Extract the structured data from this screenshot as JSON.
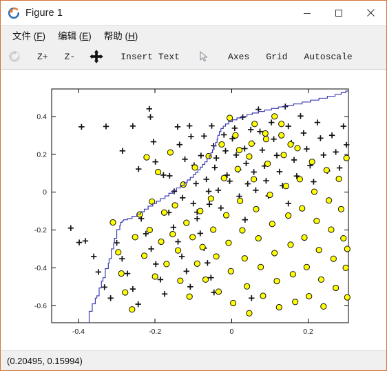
{
  "window": {
    "title": "Figure 1",
    "icon": "octave-logo-icon",
    "border_color": "#d4713a",
    "controls": [
      {
        "name": "minimize-button",
        "glyph": "minimize-icon"
      },
      {
        "name": "maximize-button",
        "glyph": "maximize-icon"
      },
      {
        "name": "close-button",
        "glyph": "close-icon"
      }
    ]
  },
  "menubar": {
    "items": [
      {
        "label": "文件 (F)",
        "text": "文件 (",
        "accel": "F",
        "tail": ")",
        "name": "menu-file"
      },
      {
        "label": "编辑 (E)",
        "text": "编辑 (",
        "accel": "E",
        "tail": ")",
        "name": "menu-edit"
      },
      {
        "label": "帮助 (H)",
        "text": "帮助 (",
        "accel": "H",
        "tail": ")",
        "name": "menu-help"
      }
    ]
  },
  "toolbar": {
    "reset_icon": "reset-rotate-icon",
    "zoom_in": "Z+",
    "zoom_out": "Z-",
    "pan_icon": "pan-move-icon",
    "insert_text": "Insert Text",
    "pointer_icon": "cursor-arrow-icon",
    "axes": "Axes",
    "grid": "Grid",
    "autoscale": "Autoscale"
  },
  "statusbar": {
    "coordinates": "(0.20495, 0.15994)"
  },
  "chart_data": {
    "type": "scatter",
    "title": "",
    "xlabel": "",
    "ylabel": "",
    "xlim": [
      -0.47,
      0.305
    ],
    "ylim": [
      -0.69,
      0.545
    ],
    "xticks": [
      -0.4,
      -0.2,
      0,
      0.2
    ],
    "xticklabels": [
      "-0.4",
      "-0.2",
      "0",
      "0.2"
    ],
    "yticks": [
      0.4,
      0.2,
      0,
      -0.2,
      -0.4,
      -0.6
    ],
    "yticklabels": [
      "0.4",
      "0.2",
      "0",
      "-0.2",
      "-0.4",
      "-0.6"
    ],
    "grid": false,
    "legend": null,
    "series": [
      {
        "name": "class-plus",
        "marker": "plus",
        "color": "#111111",
        "points": [
          [
            -0.392,
            0.345
          ],
          [
            -0.328,
            0.347
          ],
          [
            -0.285,
            0.218
          ],
          [
            -0.258,
            0.349
          ],
          [
            -0.243,
            0.122
          ],
          [
            -0.215,
            0.44
          ],
          [
            -0.212,
            0.397
          ],
          [
            -0.204,
            0.266
          ],
          [
            -0.199,
            0.16
          ],
          [
            -0.178,
            0.09
          ],
          [
            -0.162,
            0.086
          ],
          [
            -0.15,
            0.004
          ],
          [
            -0.141,
            0.345
          ],
          [
            -0.136,
            0.251
          ],
          [
            -0.128,
            -0.03
          ],
          [
            -0.122,
            0.174
          ],
          [
            -0.11,
            0.35
          ],
          [
            -0.106,
            0.294
          ],
          [
            -0.098,
            0.142
          ],
          [
            -0.093,
            0.045
          ],
          [
            -0.09,
            -0.106
          ],
          [
            -0.08,
            0.193
          ],
          [
            -0.072,
            0.296
          ],
          [
            -0.066,
            0.068
          ],
          [
            -0.06,
            0.004
          ],
          [
            -0.058,
            -0.064
          ],
          [
            -0.052,
            0.35
          ],
          [
            -0.047,
            0.245
          ],
          [
            -0.044,
            0.13
          ],
          [
            -0.04,
            0.18
          ],
          [
            -0.035,
            0.01
          ],
          [
            -0.028,
            -0.084
          ],
          [
            -0.02,
            0.303
          ],
          [
            -0.016,
            0.218
          ],
          [
            -0.012,
            0.09
          ],
          [
            -0.005,
            0.058
          ],
          [
            0.002,
            0.282
          ],
          [
            0.008,
            0.338
          ],
          [
            0.012,
            0.196
          ],
          [
            0.018,
            0.118
          ],
          [
            0.02,
            -0.022
          ],
          [
            0.029,
            0.396
          ],
          [
            0.034,
            0.23
          ],
          [
            0.038,
            0.152
          ],
          [
            0.042,
            0.044
          ],
          [
            0.05,
            0.33
          ],
          [
            0.054,
            0.258
          ],
          [
            0.058,
            0.106
          ],
          [
            0.063,
            0.01
          ],
          [
            0.07,
            0.437
          ],
          [
            0.074,
            0.32
          ],
          [
            0.08,
            0.222
          ],
          [
            0.086,
            0.138
          ],
          [
            0.09,
            0.06
          ],
          [
            0.096,
            -0.02
          ],
          [
            0.104,
            0.368
          ],
          [
            0.11,
            0.28
          ],
          [
            0.118,
            0.194
          ],
          [
            0.125,
            0.108
          ],
          [
            0.133,
            0.034
          ],
          [
            0.14,
            0.452
          ],
          [
            0.148,
            0.348
          ],
          [
            0.156,
            0.26
          ],
          [
            0.163,
            0.17
          ],
          [
            0.17,
            0.085
          ],
          [
            0.18,
            0.402
          ],
          [
            0.188,
            0.312
          ],
          [
            0.196,
            0.228
          ],
          [
            0.205,
            0.14
          ],
          [
            0.214,
            0.055
          ],
          [
            0.224,
            0.368
          ],
          [
            0.232,
            0.285
          ],
          [
            0.24,
            0.196
          ],
          [
            0.25,
            0.112
          ],
          [
            0.262,
            0.3
          ],
          [
            0.272,
            0.212
          ],
          [
            0.282,
            0.128
          ],
          [
            0.292,
            0.348
          ],
          [
            0.3,
            0.25
          ],
          [
            -0.42,
            -0.19
          ],
          [
            -0.398,
            -0.266
          ],
          [
            -0.382,
            -0.258
          ],
          [
            -0.36,
            -0.34
          ],
          [
            -0.348,
            -0.422
          ],
          [
            -0.332,
            -0.502
          ],
          [
            -0.316,
            -0.56
          ],
          [
            -0.3,
            -0.268
          ],
          [
            -0.286,
            -0.352
          ],
          [
            -0.272,
            -0.43
          ],
          [
            -0.258,
            -0.512
          ],
          [
            -0.244,
            -0.592
          ],
          [
            -0.236,
            -0.14
          ],
          [
            -0.224,
            -0.22
          ],
          [
            -0.21,
            -0.3
          ],
          [
            -0.198,
            -0.38
          ],
          [
            -0.186,
            -0.462
          ],
          [
            -0.175,
            -0.538
          ],
          [
            -0.164,
            -0.108
          ],
          [
            -0.152,
            -0.186
          ],
          [
            -0.14,
            -0.262
          ],
          [
            -0.13,
            -0.34
          ],
          [
            -0.118,
            -0.418
          ],
          [
            -0.108,
            -0.5
          ],
          [
            -0.1,
            -0.06
          ],
          [
            -0.09,
            -0.14
          ],
          [
            -0.082,
            -0.218
          ],
          [
            -0.072,
            -0.296
          ],
          [
            -0.063,
            -0.374
          ],
          [
            -0.054,
            -0.452
          ],
          [
            -0.046,
            -0.53
          ],
          [
            0.035,
            -0.146
          ],
          [
            0.052,
            -0.56
          ],
          [
            0.148,
            -0.06
          ]
        ]
      },
      {
        "name": "class-circle",
        "marker": "circle",
        "fill": "#ffff00",
        "edge": "#111111",
        "points": [
          [
            -0.31,
            -0.16
          ],
          [
            -0.296,
            -0.318
          ],
          [
            -0.288,
            -0.43
          ],
          [
            -0.278,
            -0.53
          ],
          [
            -0.26,
            -0.62
          ],
          [
            -0.252,
            -0.238
          ],
          [
            -0.24,
            -0.118
          ],
          [
            -0.228,
            -0.336
          ],
          [
            -0.222,
            0.184
          ],
          [
            -0.214,
            -0.2
          ],
          [
            -0.208,
            -0.05
          ],
          [
            -0.2,
            -0.446
          ],
          [
            -0.192,
            0.106
          ],
          [
            -0.184,
            -0.262
          ],
          [
            -0.176,
            -0.108
          ],
          [
            -0.17,
            -0.38
          ],
          [
            -0.16,
            0.21
          ],
          [
            -0.154,
            -0.222
          ],
          [
            -0.148,
            -0.07
          ],
          [
            -0.14,
            -0.308
          ],
          [
            -0.134,
            -0.468
          ],
          [
            -0.126,
            0.04
          ],
          [
            -0.118,
            -0.162
          ],
          [
            -0.11,
            -0.552
          ],
          [
            -0.102,
            -0.238
          ],
          [
            -0.096,
            0.13
          ],
          [
            -0.09,
            -0.378
          ],
          [
            -0.082,
            -0.1
          ],
          [
            -0.076,
            -0.29
          ],
          [
            -0.068,
            -0.462
          ],
          [
            -0.06,
            0.19
          ],
          [
            -0.054,
            -0.034
          ],
          [
            -0.048,
            -0.198
          ],
          [
            -0.04,
            -0.34
          ],
          [
            -0.034,
            -0.526
          ],
          [
            -0.026,
            0.252
          ],
          [
            -0.02,
            0.074
          ],
          [
            -0.014,
            -0.122
          ],
          [
            -0.008,
            -0.268
          ],
          [
            -0.002,
            -0.418
          ],
          [
            0.004,
            -0.586
          ],
          [
            0.01,
            0.3
          ],
          [
            0.016,
            0.122
          ],
          [
            0.022,
            -0.046
          ],
          [
            0.028,
            -0.202
          ],
          [
            0.034,
            -0.35
          ],
          [
            0.04,
            -0.498
          ],
          [
            0.046,
            -0.64
          ],
          [
            0.052,
            0.256
          ],
          [
            0.058,
            0.068
          ],
          [
            0.064,
            -0.09
          ],
          [
            0.07,
            -0.244
          ],
          [
            0.076,
            -0.396
          ],
          [
            0.082,
            -0.548
          ],
          [
            0.088,
            0.31
          ],
          [
            0.094,
            0.15
          ],
          [
            0.1,
            -0.014
          ],
          [
            0.106,
            -0.168
          ],
          [
            0.112,
            -0.322
          ],
          [
            0.118,
            -0.47
          ],
          [
            0.124,
            -0.608
          ],
          [
            0.13,
            0.36
          ],
          [
            0.136,
            0.196
          ],
          [
            0.142,
            0.032
          ],
          [
            0.148,
            -0.124
          ],
          [
            0.154,
            -0.278
          ],
          [
            0.16,
            -0.434
          ],
          [
            0.166,
            -0.58
          ],
          [
            0.172,
            0.232
          ],
          [
            0.178,
            0.068
          ],
          [
            0.184,
            -0.086
          ],
          [
            0.19,
            -0.24
          ],
          [
            0.196,
            -0.396
          ],
          [
            0.202,
            -0.55
          ],
          [
            0.21,
            0.16
          ],
          [
            0.216,
            0.002
          ],
          [
            0.222,
            -0.152
          ],
          [
            0.228,
            -0.306
          ],
          [
            0.234,
            -0.462
          ],
          [
            0.24,
            -0.604
          ],
          [
            0.248,
            0.116
          ],
          [
            0.254,
            -0.044
          ],
          [
            0.26,
            -0.198
          ],
          [
            0.266,
            -0.352
          ],
          [
            0.272,
            -0.506
          ],
          [
            0.28,
            0.07
          ],
          [
            0.286,
            -0.09
          ],
          [
            0.292,
            -0.244
          ],
          [
            0.298,
            -0.4
          ],
          [
            0.302,
            -0.3
          ],
          [
            0.302,
            -0.556
          ],
          [
            0.3,
            0.18
          ],
          [
            0.112,
            0.4
          ],
          [
            0.09,
            0.28
          ],
          [
            0.06,
            0.36
          ],
          [
            0.13,
            0.3
          ],
          [
            0.046,
            0.188
          ],
          [
            0.02,
            0.222
          ],
          [
            -0.005,
            0.392
          ],
          [
            0.154,
            0.252
          ]
        ]
      }
    ],
    "boundary": {
      "name": "decision-boundary",
      "color": "#3b3bb0",
      "points": [
        [
          -0.372,
          -0.69
        ],
        [
          -0.372,
          -0.64
        ],
        [
          -0.364,
          -0.63
        ],
        [
          -0.364,
          -0.6
        ],
        [
          -0.356,
          -0.59
        ],
        [
          -0.352,
          -0.56
        ],
        [
          -0.346,
          -0.548
        ],
        [
          -0.346,
          -0.52
        ],
        [
          -0.34,
          -0.506
        ],
        [
          -0.336,
          -0.47
        ],
        [
          -0.33,
          -0.452
        ],
        [
          -0.33,
          -0.42
        ],
        [
          -0.322,
          -0.404
        ],
        [
          -0.32,
          -0.376
        ],
        [
          -0.314,
          -0.352
        ],
        [
          -0.314,
          -0.318
        ],
        [
          -0.308,
          -0.3
        ],
        [
          -0.306,
          -0.268
        ],
        [
          -0.3,
          -0.244
        ],
        [
          -0.3,
          -0.216
        ],
        [
          -0.292,
          -0.198
        ],
        [
          -0.29,
          -0.176
        ],
        [
          -0.286,
          -0.16
        ],
        [
          -0.282,
          -0.152
        ],
        [
          -0.272,
          -0.146
        ],
        [
          -0.26,
          -0.14
        ],
        [
          -0.248,
          -0.128
        ],
        [
          -0.238,
          -0.116
        ],
        [
          -0.228,
          -0.104
        ],
        [
          -0.218,
          -0.09
        ],
        [
          -0.206,
          -0.074
        ],
        [
          -0.196,
          -0.06
        ],
        [
          -0.186,
          -0.048
        ],
        [
          -0.174,
          -0.034
        ],
        [
          -0.164,
          -0.02
        ],
        [
          -0.154,
          -0.006
        ],
        [
          -0.144,
          0.008
        ],
        [
          -0.134,
          0.022
        ],
        [
          -0.124,
          0.036
        ],
        [
          -0.116,
          0.05
        ],
        [
          -0.108,
          0.064
        ],
        [
          -0.1,
          0.078
        ],
        [
          -0.094,
          0.092
        ],
        [
          -0.088,
          0.104
        ],
        [
          -0.082,
          0.118
        ],
        [
          -0.076,
          0.132
        ],
        [
          -0.07,
          0.146
        ],
        [
          -0.064,
          0.16
        ],
        [
          -0.058,
          0.176
        ],
        [
          -0.054,
          0.192
        ],
        [
          -0.05,
          0.208
        ],
        [
          -0.046,
          0.224
        ],
        [
          -0.042,
          0.244
        ],
        [
          -0.038,
          0.262
        ],
        [
          -0.036,
          0.28
        ],
        [
          -0.032,
          0.3
        ],
        [
          -0.028,
          0.32
        ],
        [
          -0.022,
          0.336
        ],
        [
          -0.016,
          0.348
        ],
        [
          -0.008,
          0.36
        ],
        [
          0.002,
          0.372
        ],
        [
          0.014,
          0.382
        ],
        [
          0.026,
          0.392
        ],
        [
          0.04,
          0.4
        ],
        [
          0.054,
          0.41
        ],
        [
          0.07,
          0.418
        ],
        [
          0.086,
          0.426
        ],
        [
          0.104,
          0.434
        ],
        [
          0.122,
          0.442
        ],
        [
          0.142,
          0.45
        ],
        [
          0.162,
          0.458
        ],
        [
          0.184,
          0.466
        ],
        [
          0.206,
          0.476
        ],
        [
          0.228,
          0.486
        ],
        [
          0.25,
          0.496
        ],
        [
          0.27,
          0.506
        ],
        [
          0.286,
          0.516
        ],
        [
          0.298,
          0.526
        ],
        [
          0.305,
          0.534
        ]
      ]
    }
  }
}
